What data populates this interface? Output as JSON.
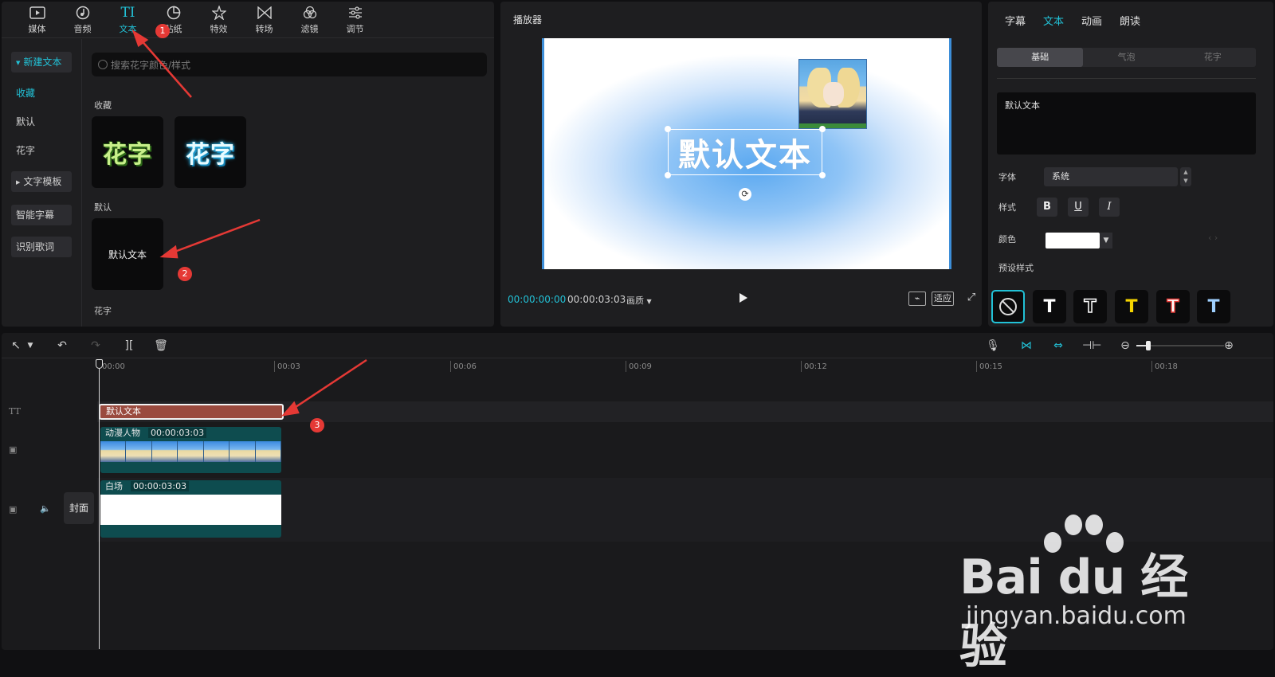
{
  "media_panel": {
    "tabs": [
      {
        "label": "媒体",
        "icon": "media-icon"
      },
      {
        "label": "音频",
        "icon": "audio-icon"
      },
      {
        "label": "文本",
        "icon": "text-icon"
      },
      {
        "label": "贴纸",
        "icon": "sticker-icon"
      },
      {
        "label": "特效",
        "icon": "effects-icon"
      },
      {
        "label": "转场",
        "icon": "transition-icon"
      },
      {
        "label": "滤镜",
        "icon": "filter-icon"
      },
      {
        "label": "调节",
        "icon": "adjust-icon"
      }
    ],
    "sidebar": {
      "new_text": "新建文本",
      "favorites": "收藏",
      "default": "默认",
      "fancy": "花字",
      "templates": "文字模板",
      "smart_captions": "智能字幕",
      "lyrics": "识别歌词"
    },
    "search_placeholder": "搜索花字颜色/样式",
    "sections": {
      "favorites": "收藏",
      "default": "默认",
      "fancy": "花字"
    },
    "favorite_items": [
      "花字",
      "花字"
    ],
    "default_item": "默认文本"
  },
  "player": {
    "title": "播放器",
    "canvas_text": "默认文本",
    "time_current": "00:00:00:00",
    "time_total": "00:00:03:03",
    "quality": "画质",
    "fit": "适应"
  },
  "inspector": {
    "tabs": [
      "字幕",
      "文本",
      "动画",
      "朗读"
    ],
    "segments": [
      "基础",
      "气泡",
      "花字"
    ],
    "text_value": "默认文本",
    "font_label": "字体",
    "font_value": "系统",
    "style_label": "样式",
    "color_label": "颜色",
    "color_value": "#ffffff",
    "preset_label": "预设样式",
    "style_buttons": [
      "B",
      "U",
      "I"
    ],
    "presets": [
      "T",
      "T",
      "T",
      "T",
      "T"
    ]
  },
  "timeline": {
    "ticks": [
      "00:00",
      "00:03",
      "00:06",
      "00:09",
      "00:12",
      "00:15",
      "00:18"
    ],
    "text_clip": "默认文本",
    "video_clip": {
      "name": "动漫人物",
      "duration": "00:00:03:03"
    },
    "white_clip": {
      "name": "白场",
      "duration": "00:00:03:03"
    },
    "cover": "封面"
  },
  "annotations": [
    "1",
    "2",
    "3"
  ],
  "watermark": {
    "brand": "Bai du 经验",
    "url": "jingyan.baidu.com"
  },
  "colors": {
    "accent": "#22c1d6",
    "annotation": "#e53935",
    "text_clip": "#9a4a3e",
    "video_clip": "#0e4c4f"
  }
}
